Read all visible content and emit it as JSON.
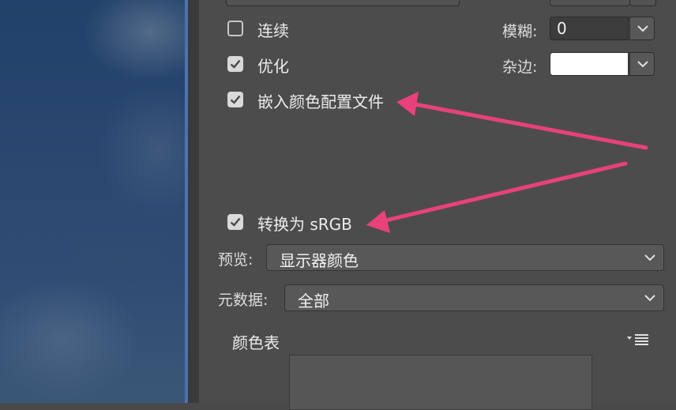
{
  "options": {
    "continuous_label": "连续",
    "continuous_checked": false,
    "optimize_label": "优化",
    "optimize_checked": true,
    "embed_profile_label": "嵌入颜色配置文件",
    "embed_profile_checked": true,
    "convert_srgb_label": "转换为 sRGB",
    "convert_srgb_checked": true
  },
  "blur": {
    "label": "模糊:",
    "value": "0"
  },
  "matte": {
    "label": "杂边:",
    "color": "#ffffff"
  },
  "preview": {
    "label": "预览:",
    "value": "显示器颜色"
  },
  "metadata": {
    "label": "元数据:",
    "value": "全部"
  },
  "color_table": {
    "title": "颜色表",
    "menu_icon": "dropdown-list-icon"
  },
  "annotation": {
    "arrow_color": "#e8417c"
  }
}
